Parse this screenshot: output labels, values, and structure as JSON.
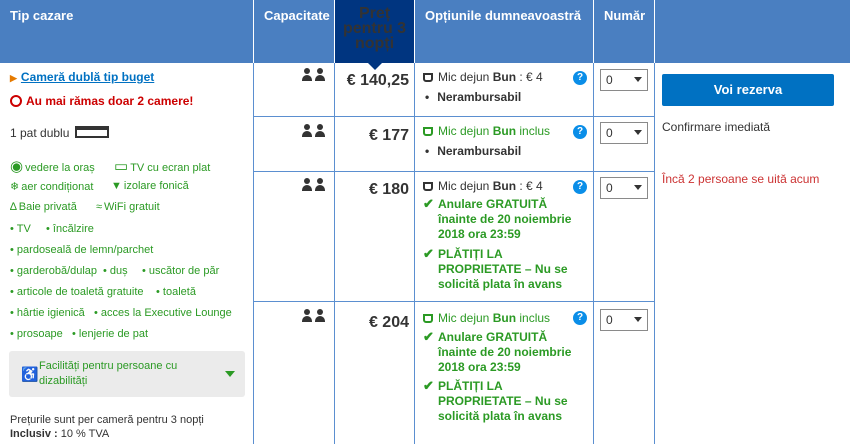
{
  "columns": {
    "room_type": "Tip cazare",
    "capacity": "Capacitate",
    "price": "Preț pentru 3 nopți",
    "options": "Opțiunile dumneavoastră",
    "number": "Număr"
  },
  "room": {
    "name": "Cameră dublă tip buget",
    "urgency": "Au mai rămas doar 2 camere!",
    "bed": "1 pat dublu",
    "features": [
      "vedere la oraș",
      "TV cu ecran plat",
      "aer condiționat",
      "izolare fonică",
      "Baie privată",
      "WiFi gratuit"
    ],
    "amenities": [
      "TV",
      "încălzire",
      "pardoseală de lemn/parchet",
      "garderobă/dulap",
      "duș",
      "uscător de păr",
      "articole de toaletă gratuite",
      "toaletă",
      "hârtie igienică",
      "acces la Executive Lounge",
      "prosoape",
      "lenjerie de pat"
    ],
    "accessibility": "Facilități pentru persoane cu dizabilități",
    "price_note": "Prețurile sunt per cameră pentru 3 nopți",
    "tax_label": "Inclusiv :",
    "tax_value": "10 % TVA"
  },
  "offers": [
    {
      "price": "€ 140,25",
      "breakfast_prefix": "Mic dejun",
      "breakfast_bold": "Bun",
      "breakfast_suffix": ": € 4",
      "policy": "Nerambursabil",
      "qty": "0"
    },
    {
      "price": "€ 177",
      "breakfast_prefix": "Mic dejun",
      "breakfast_bold": "Bun",
      "breakfast_suffix": "inclus",
      "policy": "Nerambursabil",
      "qty": "0"
    },
    {
      "price": "€ 180",
      "breakfast_prefix": "Mic dejun",
      "breakfast_bold": "Bun",
      "breakfast_suffix": ": € 4",
      "cancel_bold": "Anulare GRATUITĂ",
      "cancel_rest": "înainte de 20 noiembrie 2018 ora 23:59",
      "pay_bold": "PLĂTIȚI LA PROPRIETATE",
      "pay_rest": "– Nu se solicită plata în avans",
      "qty": "0"
    },
    {
      "price": "€ 204",
      "breakfast_prefix": "Mic dejun",
      "breakfast_bold": "Bun",
      "breakfast_suffix": "inclus",
      "cancel_bold": "Anulare GRATUITĂ",
      "cancel_rest": "înainte de 20 noiembrie 2018 ora 23:59",
      "pay_bold": "PLĂTIȚI LA PROPRIETATE",
      "pay_rest": "– Nu se solicită plata în avans",
      "qty": "0"
    }
  ],
  "booking": {
    "button": "Voi rezerva",
    "confirmation": "Confirmare imediată",
    "viewers": "Încă 2 persoane se uită acum"
  },
  "colors": {
    "header": "#4a7fc1",
    "price_header": "#003580",
    "link": "#0071c2",
    "green": "#2b9a24",
    "urgent": "#cc0000"
  }
}
